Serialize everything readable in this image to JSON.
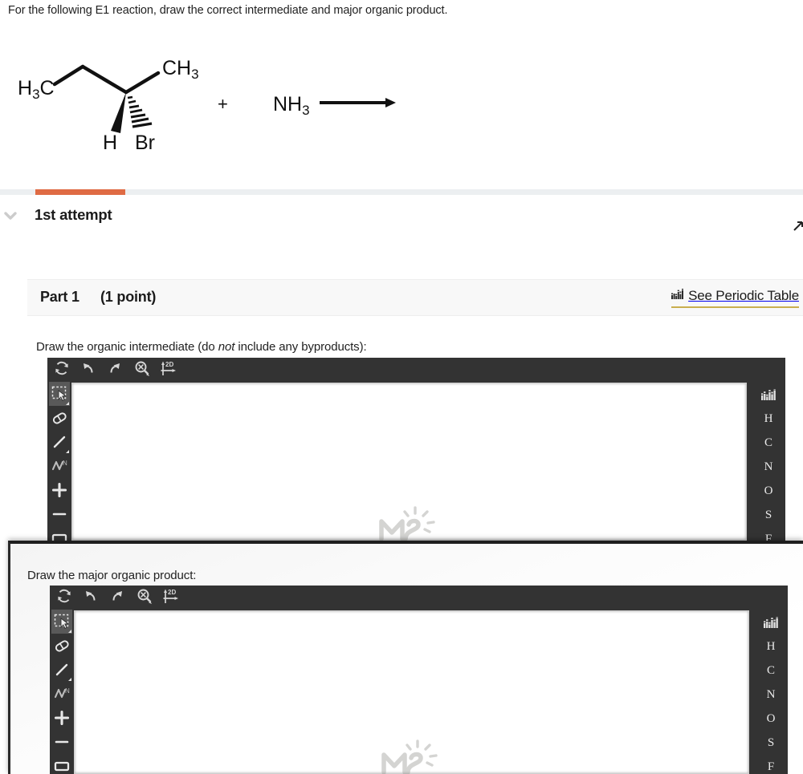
{
  "prompt": "For the following E1 reaction, draw the correct intermediate and major organic product.",
  "scheme": {
    "reactant_labels": [
      "H₃C",
      "CH₃",
      "H",
      "Br"
    ],
    "label_h3c": "H",
    "label_h3c_sub": "3",
    "label_h3c_tail": "C",
    "label_ch3": "CH",
    "label_ch3_sub": "3",
    "label_h": "H",
    "label_br": "Br",
    "plus": "+",
    "reagent": "NH",
    "reagent_sub": "3",
    "arrow_name": "reaction-arrow"
  },
  "attempt": {
    "title": "1st attempt",
    "tab_color": "#df6b44",
    "track_color": "#eceff1",
    "chevron": "chevron-down-icon"
  },
  "part": {
    "label": "Part 1",
    "points": "(1 point)",
    "periodic_table_link": "See Periodic Table",
    "underline_color": "#c9ae4e"
  },
  "questions": [
    {
      "id": "intermediate",
      "text_before": "Draw the organic intermediate (do ",
      "text_italic": "not",
      "text_after": " include any byproducts):"
    },
    {
      "id": "product",
      "text": "Draw the major organic product:"
    }
  ],
  "editor": {
    "toolbar_tools": [
      {
        "name": "reset-icon",
        "label": "Reset"
      },
      {
        "name": "undo-icon",
        "label": "Undo"
      },
      {
        "name": "redo-icon",
        "label": "Redo"
      },
      {
        "name": "zoom-out-icon",
        "label": "Zoom out"
      },
      {
        "name": "clean-2d-icon",
        "label": "2D"
      }
    ],
    "clean_2d_label": "2D",
    "left_tools": [
      {
        "name": "select-rectangle-tool",
        "label": "Select",
        "selected": true
      },
      {
        "name": "eraser-tool",
        "label": "Eraser",
        "selected": false
      },
      {
        "name": "single-bond-tool",
        "label": "Single bond",
        "selected": false
      },
      {
        "name": "chain-tool",
        "label": "Chain",
        "selected": false
      },
      {
        "name": "increase-charge-tool",
        "label": "+",
        "selected": false
      },
      {
        "name": "decrease-charge-tool",
        "label": "−",
        "selected": false
      },
      {
        "name": "template-rectangle-tool",
        "label": "Template",
        "selected": false
      }
    ],
    "element_palette": [
      {
        "name": "periodic-table-icon",
        "label": ""
      },
      {
        "name": "element-h",
        "label": "H"
      },
      {
        "name": "element-c",
        "label": "C"
      },
      {
        "name": "element-n",
        "label": "N"
      },
      {
        "name": "element-o",
        "label": "O"
      },
      {
        "name": "element-s",
        "label": "S"
      },
      {
        "name": "element-f",
        "label": "F"
      }
    ],
    "watermark": "marvin-js-watermark",
    "toolbar_bg": "#333333",
    "canvas_bg": "#ffffff"
  }
}
